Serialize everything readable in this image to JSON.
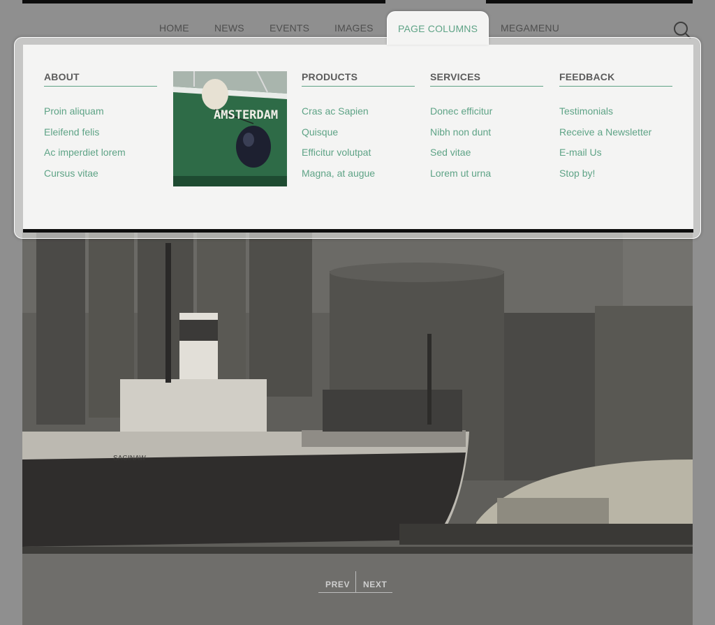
{
  "nav": {
    "items": [
      {
        "label": "HOME"
      },
      {
        "label": "NEWS"
      },
      {
        "label": "EVENTS"
      },
      {
        "label": "IMAGES"
      },
      {
        "label": "PAGE COLUMNS",
        "active": true
      },
      {
        "label": "MEGAMENU"
      }
    ],
    "search_icon": "search-icon"
  },
  "mega": {
    "columns": [
      {
        "heading": "ABOUT",
        "links": [
          "Proin aliquam",
          "Eleifend felis",
          "Ac imperdiet lorem",
          "Cursus vitae"
        ]
      },
      {
        "heading": "PRODUCTS",
        "links": [
          "Cras ac Sapien",
          "Quisque",
          "Efficitur volutpat",
          "Magna, at augue"
        ]
      },
      {
        "heading": "SERVICES",
        "links": [
          "Donec efficitur",
          "Nibh non dunt",
          "Sed vitae",
          "Lorem ut urna"
        ]
      },
      {
        "heading": "FEEDBACK",
        "links": [
          "Testimonials",
          "Receive a Newsletter",
          "E-mail Us",
          "Stop by!"
        ]
      }
    ],
    "photo_text": "AMSTERDAM"
  },
  "hero": {
    "ship_name": "SAGINAW"
  },
  "pager": {
    "prev": "PREV",
    "next": "NEXT"
  },
  "colors": {
    "accent": "#5ea386",
    "panel": "#f4f4f3",
    "nav_text": "#4e4e4e",
    "bar": "#0d0d0d"
  }
}
